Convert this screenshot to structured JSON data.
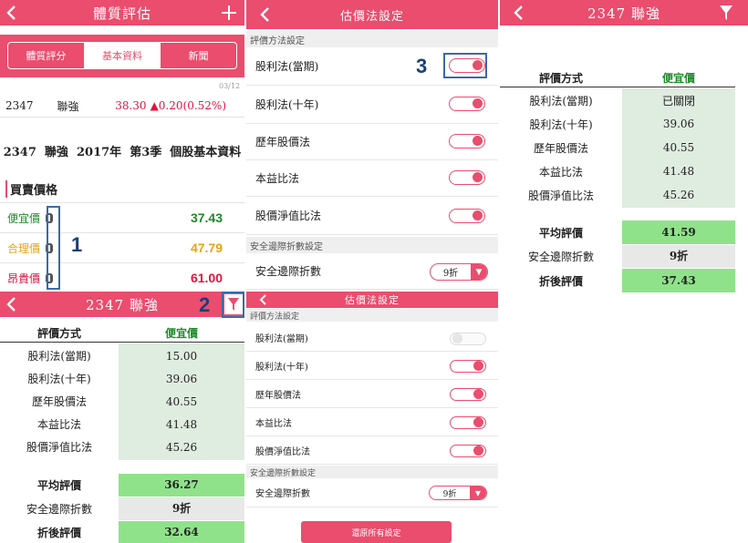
{
  "panel_valuation": {
    "header": {
      "title": "體質評估",
      "back_icon": "chevron-left-icon",
      "add_icon": "plus-icon"
    },
    "tabs": [
      {
        "label": "體質評分",
        "active": false
      },
      {
        "label": "基本資料",
        "active": true
      },
      {
        "label": "新聞",
        "active": false
      }
    ],
    "quote": {
      "date": "03/12",
      "code": "2347",
      "name": "聯強",
      "price": "38.30",
      "change": "0.20(0.52%)"
    },
    "title": "2347  聯強  2017年  第3季  個股基本資料",
    "section_title": "買賣價格",
    "prices": [
      {
        "label": "便宜價",
        "value": "37.43",
        "color": "#1e8a2a"
      },
      {
        "label": "合理價",
        "value": "47.79",
        "color": "#e8a317"
      },
      {
        "label": "昂貴價",
        "value": "61.00",
        "color": "#e3133f"
      }
    ],
    "annotation": "1"
  },
  "panel_eval_1": {
    "header": {
      "title": "2347 聯強",
      "back_icon": "chevron-left-icon",
      "filter_icon": "filter-icon"
    },
    "col_method": "評價方式",
    "col_value": "便宜價",
    "rows": [
      {
        "method": "股利法(當期)",
        "value": "15.00"
      },
      {
        "method": "股利法(十年)",
        "value": "39.06"
      },
      {
        "method": "歷年股價法",
        "value": "40.55"
      },
      {
        "method": "本益比法",
        "value": "41.48"
      },
      {
        "method": "股價淨值比法",
        "value": "45.26"
      }
    ],
    "avg_label": "平均評價",
    "avg_value": "36.27",
    "margin_label": "安全邊際折數",
    "margin_value": "9折",
    "final_label": "折後評價",
    "final_value": "32.64",
    "annotation": "2"
  },
  "panel_settings_1": {
    "header": {
      "title": "估價法設定",
      "back_icon": "chevron-left-icon"
    },
    "section_methods": "評價方法設定",
    "methods": [
      {
        "label": "股利法(當期)",
        "on": true
      },
      {
        "label": "股利法(十年)",
        "on": true
      },
      {
        "label": "歷年股價法",
        "on": true
      },
      {
        "label": "本益比法",
        "on": true
      },
      {
        "label": "股價淨值比法",
        "on": true
      }
    ],
    "section_margin": "安全邊際折數設定",
    "margin_label": "安全邊際折數",
    "margin_value": "9折",
    "annotation": "3"
  },
  "panel_settings_2": {
    "header": {
      "title": "估價法設定",
      "back_icon": "chevron-left-icon"
    },
    "section_methods": "評價方法設定",
    "methods": [
      {
        "label": "股利法(當期)",
        "on": false
      },
      {
        "label": "股利法(十年)",
        "on": true
      },
      {
        "label": "歷年股價法",
        "on": true
      },
      {
        "label": "本益比法",
        "on": true
      },
      {
        "label": "股價淨值比法",
        "on": true
      }
    ],
    "section_margin": "安全邊際折數設定",
    "margin_label": "安全邊際折數",
    "margin_value": "9折",
    "reset_label": "還原所有設定"
  },
  "panel_eval_2": {
    "header": {
      "title": "2347 聯強",
      "back_icon": "chevron-left-icon",
      "filter_icon": "filter-icon"
    },
    "col_method": "評價方式",
    "col_value": "便宜價",
    "rows": [
      {
        "method": "股利法(當期)",
        "value": "已關閉"
      },
      {
        "method": "股利法(十年)",
        "value": "39.06"
      },
      {
        "method": "歷年股價法",
        "value": "40.55"
      },
      {
        "method": "本益比法",
        "value": "41.48"
      },
      {
        "method": "股價淨值比法",
        "value": "45.26"
      }
    ],
    "avg_label": "平均評價",
    "avg_value": "41.59",
    "margin_label": "安全邊際折數",
    "margin_value": "9折",
    "final_label": "折後評價",
    "final_value": "37.43"
  }
}
